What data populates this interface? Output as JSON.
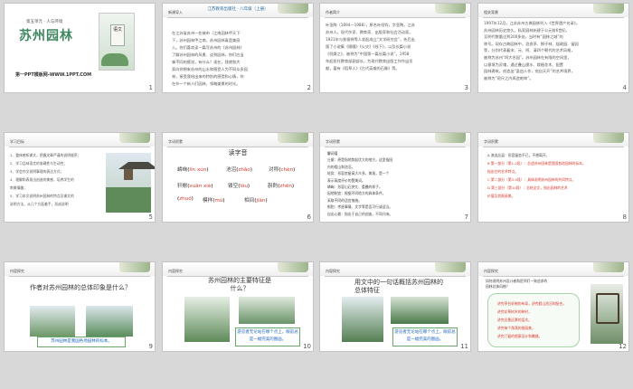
{
  "slides": [
    {
      "num": "1",
      "title": "苏州园林",
      "subtitle": "第五单元 · 人与环境",
      "url": "第一PPT模板网-WWW.1PPT.COM",
      "poster_text": "语文"
    },
    {
      "num": "2",
      "tag": "新课导入",
      "header": "江苏教育出版社 · 八年级（上册）",
      "lines": [
        "在江苏省苏州一些城市（江南园林甲天下",
        "下，苏州园林甲江南，苏州园林真是美丽",
        "入。你们喜欢读一篇写苏州的《苏州园林》",
        "了解苏州园林的风景、谈到园林，你们应当",
        "拿不同的感觉，有什么？现在，我就和大",
        "家向你想来苏州的山水和感受人为不同众多园",
        "林，接受我给出来的特别的感受和心情，你",
        "在外一个新人们园林，领略美景的时光。"
      ]
    },
    {
      "num": "3",
      "tag": "作者简介",
      "lines": [
        "叶圣陶（1894—1988），原名叶绍钧，字圣陶，江苏",
        "苏州人。现代作家、教育家、出版家和社会活动家。",
        "1921年与郑振铎等人发起成立“文学研究会”，先后出",
        "版了小说集《隔膜》《火灾》《线下》，以及长篇小说",
        "《倪焕之》，被称为“中国第一篇长篇小说”。1958",
        "年起担任教育部副部长，为现代教育出版工作作出贡",
        "献，著有《稻草人》《古代英雄的石像》等。"
      ]
    },
    {
      "num": "4",
      "tag": "相关背景",
      "lines": [
        "1997年12月，江苏苏州古典园林列入《世界遗产名录》。",
        "苏州园林历史悠久，私家园林始建于公元前6世纪，",
        "至明代数量达到200多处，当时有“园林之城”的",
        "称号。现存古典园林中，沧浪亭、狮子林、拙政园、留园",
        "等，分别代表着宋、元、明、清四个朝代的艺术风格，",
        "被称为苏州“四大名园”。苏州园林在有限的空间里，",
        "以意境为灵魂，通过叠山理水、栽植花木、配置",
        "园林建筑，创造出“虽由人作，宛自天开”的艺术境界，",
        "被称为“咫尺之内再造乾坤”。"
      ]
    },
    {
      "num": "5",
      "tag": "学习目标",
      "goals": [
        "1、整体感知课文，把握文章严谨的说明顺序；",
        "2、学习品味语言的准确性与生动性；",
        "3、学会作文说明事理的表达方式；",
        "4、理解和表现出创造的美感，培养学生的",
        "   审美情趣；",
        "5、学习本文说明苏州园林的特点及课文的",
        "   说明方法，从几个方面着手，形成说明"
      ]
    },
    {
      "num": "6",
      "tag": "字词积累",
      "heading": "读字音",
      "words": [
        [
          "嶙峋",
          "lín xún"
        ],
        [
          "池沼",
          "zhǎo"
        ],
        [
          "对称",
          "chèn"
        ],
        [
          "轩榭",
          "xuān xiè"
        ],
        [
          "镂空",
          "lòu"
        ],
        [
          "斟酌",
          "zhēn",
          "zhuó"
        ],
        [
          "模样",
          "mú"
        ],
        [
          "相间",
          "jiàn"
        ]
      ]
    },
    {
      "num": "7",
      "tag": "字词积累",
      "sec": "解词语",
      "defs": [
        "丘壑：原是指地势起伏大的地方，这里指园",
        "  内的假山和池沼。",
        "轮奂：形容房屋高大众多，美观，是一个",
        "  表示高度评价的赞美词。",
        "嶙峋：形容山石突兀、重叠的样子。",
        "因地制宜：根据不同地方的具体条件，",
        "  采取不同的适宜措施。",
        "斟酌：考虑事情、文字等是否可行或适当。",
        "自出心裁：指出于自己的创造，不同凡响。"
      ]
    },
    {
      "num": "8",
      "tag": "字词积累",
      "items": [
        "A 流连忘返：形容留恋不已，不想离开。",
        "B 第一部分（第1-2段）：总述苏州园林是我国各地园林的标本，",
        "  指出它的艺术特点。",
        "C 第二部分（第3-9段）：具体说明苏州园林的共同特点。",
        "D 第三部分（第10段）：总结全文，指出园林的艺术",
        "  价值及其图画美。"
      ]
    },
    {
      "num": "9",
      "tag": "内容探究",
      "question": "作者对苏州园林的总体印象是什么？",
      "answer": "苏州园林是我国各地园林的标本。"
    },
    {
      "num": "10",
      "tag": "内容探究",
      "question": "苏州园林的主要特征是什么？",
      "answer": "游览者无论站在哪个点上，眼前总是一幅完美的图画。"
    },
    {
      "num": "11",
      "tag": "内容探究",
      "question": "用文中的一句话概括苏州园林的总体特征",
      "answer": "游览者无论站在哪个点上，眼前总是一幅完美的图画。"
    },
    {
      "num": "12",
      "tag": "内容探究",
      "question": [
        "如何说明苏州设计者和匠师们一致追求的",
        "园林总体风格？"
      ],
      "bubble": [
        "讲究亭台轩榭的布局，讲究假山池沼的配合，",
        "讲究花草树木的映衬，",
        "讲究近景远景的层次。",
        "讲究每个角落的图画美，",
        "讲究门窗的图案设计和雕镂。"
      ]
    }
  ],
  "colors": {
    "green": "#3e8660",
    "red": "#d9382c",
    "blue": "#2266bb"
  }
}
